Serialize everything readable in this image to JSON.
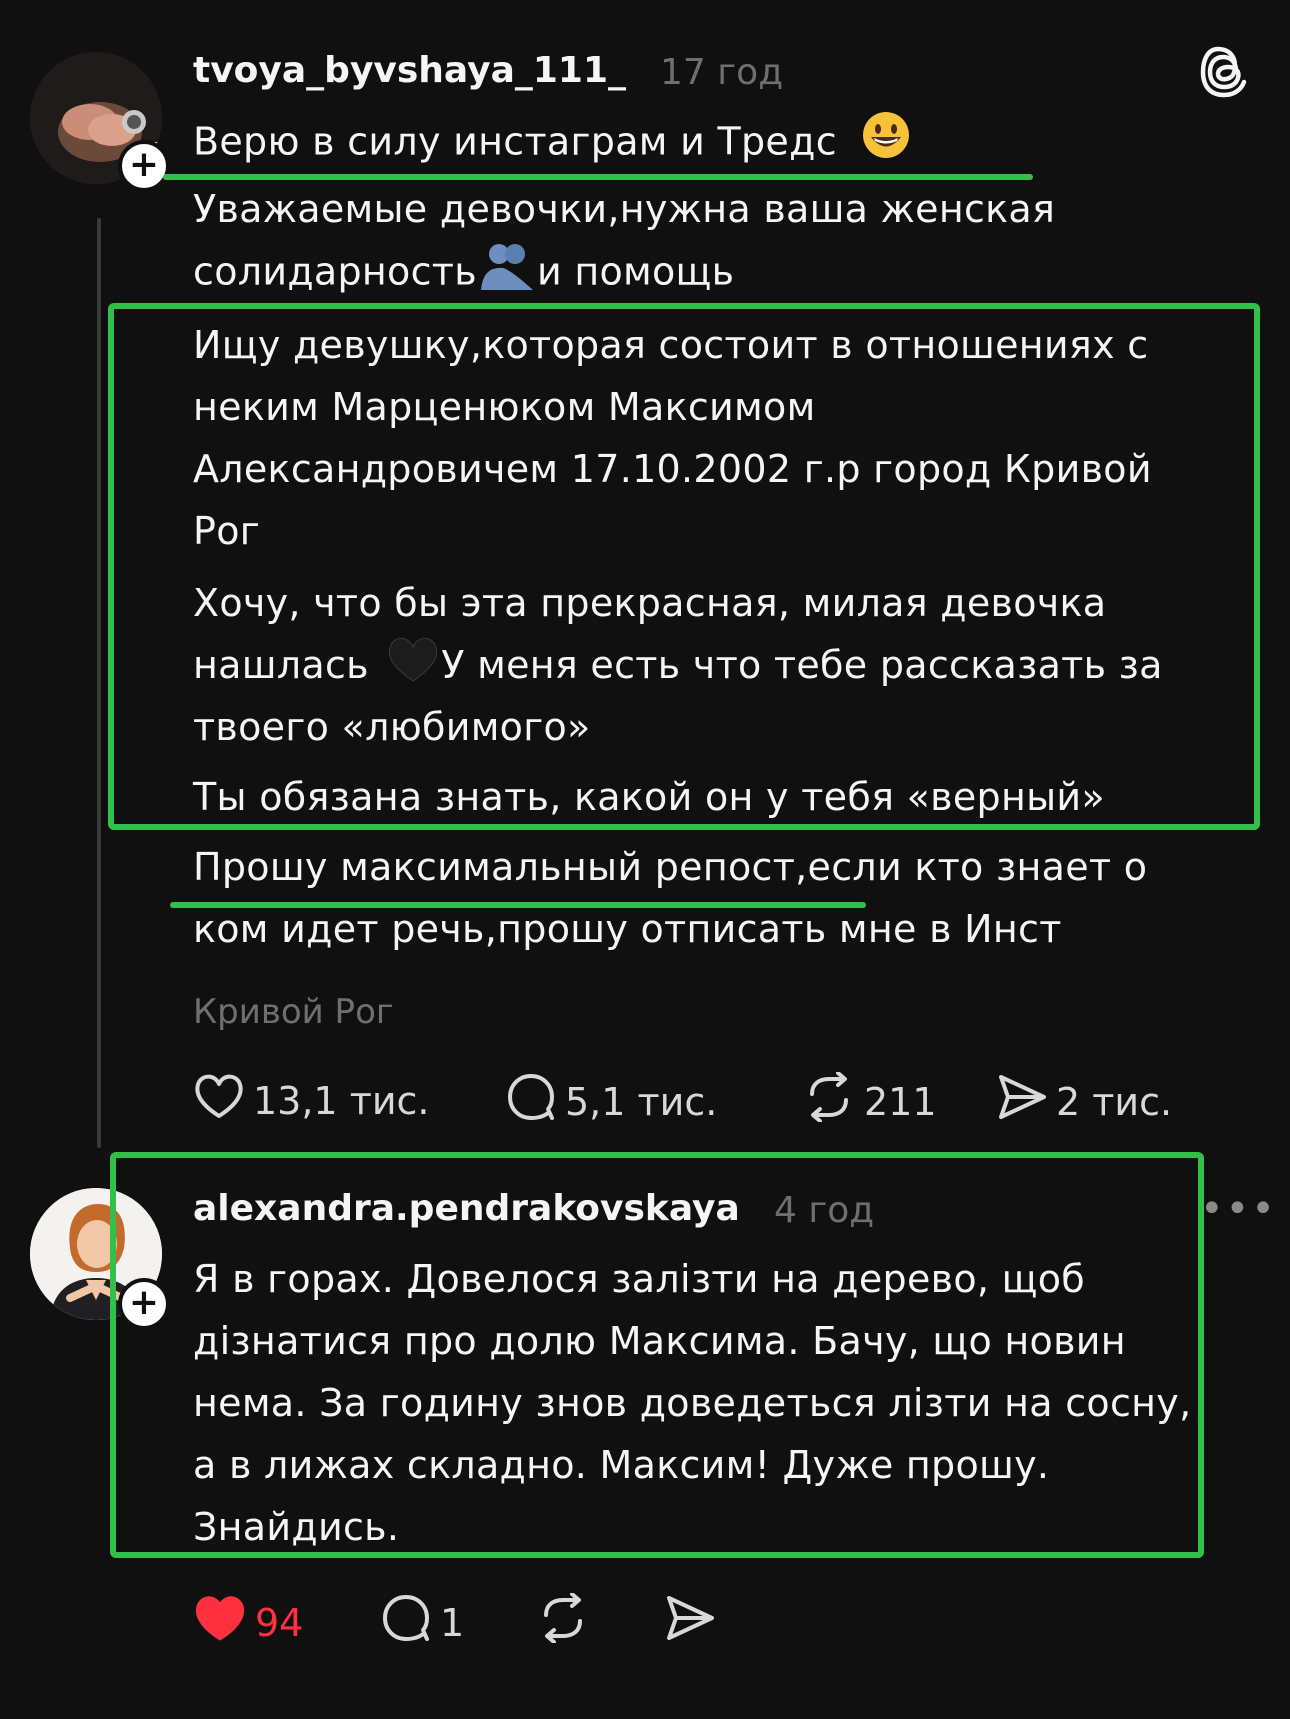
{
  "post": {
    "username": "tvoya_byvshaya_111_",
    "time": "17 год",
    "lines": [
      "Верю в силу инстаграм и Тредс",
      "Уважаемые девочки,нужна ваша женская",
      "солидарность",
      "и помощь",
      "Ищу девушку,которая состоит в отношениях с",
      "неким Марценюком Максимом",
      "Александровичем 17.10.2002 г.р город Кривой",
      "Рог",
      "Хочу, что бы эта прекрасная, милая девочка",
      "нашлась",
      "У меня есть что тебе рассказать за",
      "твоего «любимого»",
      "Ты обязана знать, какой он у тебя «верный»",
      "Прошу максимальный репост,если кто знает о",
      "ком идет речь,прошу отписать мне в Инст"
    ],
    "location": "Кривой Рог",
    "actions": {
      "likes": "13,1 тис.",
      "comments": "5,1 тис.",
      "reposts": "211",
      "shares": "2 тис."
    }
  },
  "reply": {
    "username": "alexandra.pendrakovskaya",
    "time": "4 год",
    "lines": [
      "Я в горах. Довелося залізти на дерево, щоб",
      "дізнатися про долю Максима. Бачу, що новин",
      "нема. За годину знов доведеться лізти на сосну,",
      "а в лижах складно. Максим! Дуже прошу.",
      "Знайдись."
    ],
    "actions": {
      "likes": "94",
      "comments": "1"
    }
  },
  "icons": {
    "logo": "threads-logo-icon",
    "like": "heart-icon",
    "comment": "comment-bubble-icon",
    "repost": "repost-icon",
    "share": "send-icon",
    "more": "more-icon",
    "follow": "plus-icon"
  },
  "colors": {
    "background": "#101010",
    "text": "#f3f5f7",
    "muted": "#6f6f6f",
    "annotation": "#33c04a",
    "liked": "#ff3040"
  }
}
